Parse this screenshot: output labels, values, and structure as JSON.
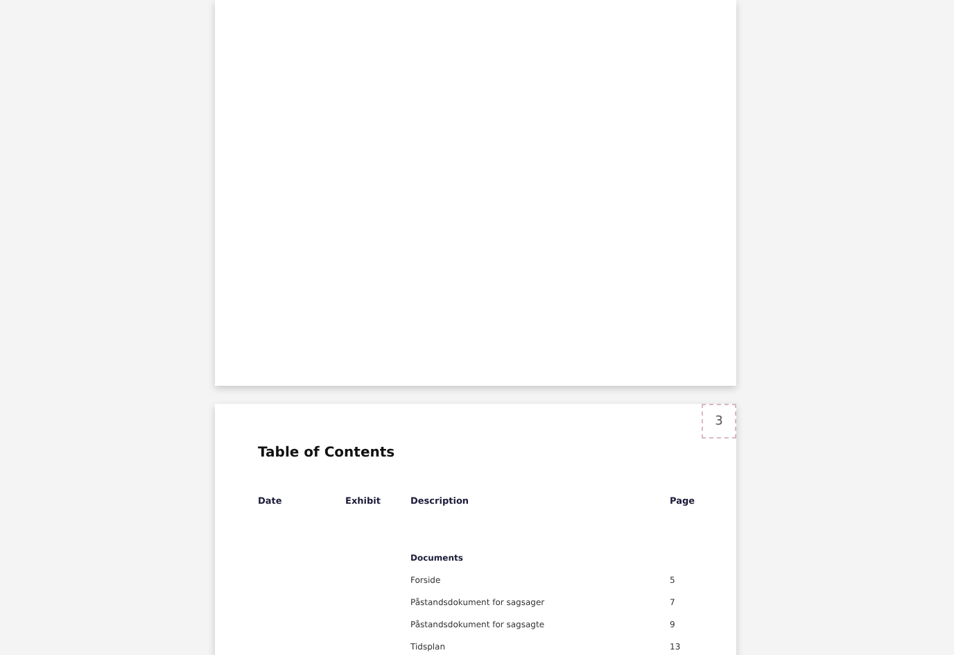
{
  "pages": [
    {
      "kind": "blank"
    },
    {
      "page_number": "3",
      "title": "Table of Contents",
      "columns": [
        "Date",
        "Exhibit",
        "Description",
        "Page"
      ],
      "sections": [
        {
          "heading": "Documents",
          "entries": [
            {
              "description": "Forside",
              "page": "5"
            },
            {
              "description": "Påstandsdokument for sagsager",
              "page": "7"
            },
            {
              "description": "Påstandsdokument for sagsagte",
              "page": "9"
            },
            {
              "description": "Tidsplan",
              "page": "13"
            }
          ]
        }
      ]
    }
  ]
}
